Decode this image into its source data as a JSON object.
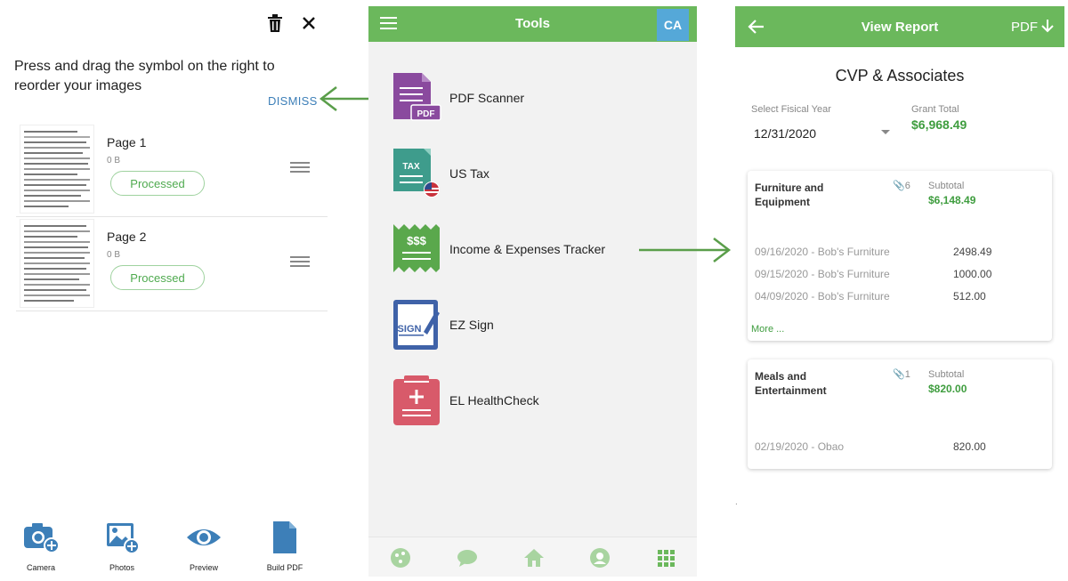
{
  "panel1": {
    "instructions": "Press and drag the symbol on the right to reorder your images",
    "dismiss": "DISMISS",
    "pages": [
      {
        "title": "Page 1",
        "size": "0 B",
        "status": "Processed"
      },
      {
        "title": "Page 2",
        "size": "0 B",
        "status": "Processed"
      }
    ],
    "bottom_bar": [
      {
        "label": "Camera",
        "icon": "camera-add-icon"
      },
      {
        "label": "Photos",
        "icon": "photo-add-icon"
      },
      {
        "label": "Preview",
        "icon": "eye-icon"
      },
      {
        "label": "Build PDF",
        "icon": "document-icon"
      }
    ],
    "accent_color": "#3d7fb8"
  },
  "panel2": {
    "header_title": "Tools",
    "avatar_initials": "CA",
    "tools": [
      {
        "label": "PDF Scanner",
        "icon": "pdf-scanner-icon",
        "color": "#8a4a9e"
      },
      {
        "label": "US Tax",
        "icon": "tax-doc-icon",
        "color": "#3e9c8c"
      },
      {
        "label": "Income & Expenses Tracker",
        "icon": "receipt-icon",
        "color": "#5aa84c"
      },
      {
        "label": "EZ Sign",
        "icon": "sign-tablet-icon",
        "color": "#3f62a8"
      },
      {
        "label": "EL HealthCheck",
        "icon": "health-clipboard-icon",
        "color": "#d85a6a"
      }
    ],
    "footer_icons": [
      "palette-icon",
      "chat-icon",
      "home-icon",
      "profile-icon",
      "grid-icon"
    ],
    "header_color": "#6bb85c",
    "avatar_color": "#55a8d8"
  },
  "panel3": {
    "header_title": "View Report",
    "pdf_label": "PDF",
    "company": "CVP & Associates",
    "fiscal_year_label": "Select Fisical Year",
    "fiscal_year_value": "12/31/2020",
    "grant_total_label": "Grant Total",
    "grant_total_value": "$6,968.49",
    "cards": [
      {
        "name_line1": "Furniture and",
        "name_line2": "Equipment",
        "attachments": "6",
        "subtotal_label": "Subtotal",
        "subtotal": "$6,148.49",
        "rows": [
          {
            "desc": "09/16/2020 - Bob's Furniture",
            "amount": "2498.49"
          },
          {
            "desc": "09/15/2020 - Bob's Furniture",
            "amount": "1000.00"
          },
          {
            "desc": "04/09/2020 - Bob's Furniture",
            "amount": "512.00"
          }
        ],
        "more": "More ..."
      },
      {
        "name_line1": "Meals and",
        "name_line2": "Entertainment",
        "attachments": "1",
        "subtotal_label": "Subtotal",
        "subtotal": "$820.00",
        "rows": [
          {
            "desc": "02/19/2020 - Obao",
            "amount": "820.00"
          }
        ]
      }
    ],
    "footnote": ".",
    "accent_green": "#3f9d3f"
  },
  "arrow_color": "#5a9e4a"
}
